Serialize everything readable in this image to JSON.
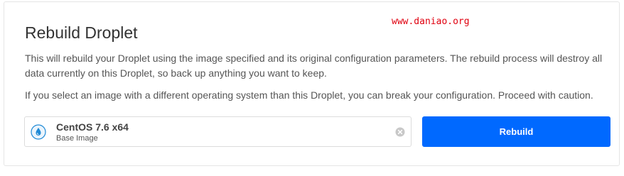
{
  "header": {
    "title": "Rebuild Droplet",
    "watermark": "www.daniao.org"
  },
  "description": {
    "paragraph1": "This will rebuild your Droplet using the image specified and its original configuration parameters. The rebuild process will destroy all data currently on this Droplet, so back up anything you want to keep.",
    "paragraph2": "If you select an image with a different operating system than this Droplet, you can break your configuration. Proceed with caution."
  },
  "image_select": {
    "name": "CentOS 7.6 x64",
    "subtitle": "Base Image",
    "icon": "centos-drop-icon",
    "clear_icon": "clear-circle-icon"
  },
  "actions": {
    "rebuild_label": "Rebuild"
  },
  "colors": {
    "primary": "#0069ff",
    "watermark": "#e0000f",
    "icon_accent": "#1f8ad6"
  }
}
